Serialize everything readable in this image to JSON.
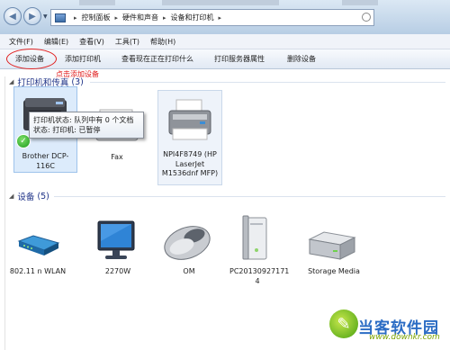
{
  "address_bar": {
    "path": [
      "控制面板",
      "硬件和声音",
      "设备和打印机"
    ]
  },
  "menu": {
    "items": [
      "文件(F)",
      "编辑(E)",
      "查看(V)",
      "工具(T)",
      "帮助(H)"
    ]
  },
  "command_bar": {
    "add_device": "添加设备",
    "add_printer": "添加打印机",
    "see_printing": "查看现在正在打印什么",
    "print_server": "打印服务器属性",
    "remove_device": "删除设备"
  },
  "annotation": "点击添加设备",
  "printers_section": {
    "title": "打印机和传真",
    "count": "(3)",
    "items": [
      {
        "label": "Brother DCP-116C",
        "icon": "multifunction-printer-icon"
      },
      {
        "label": "Fax",
        "icon": "fax-icon"
      },
      {
        "label": "NPI4F8749 (HP LaserJet M1536dnf MFP)",
        "icon": "laser-printer-icon"
      }
    ]
  },
  "tooltip": {
    "line1": "打印机状态: 队列中有 0 个文档",
    "line2": "状态: 打印机: 已暂停"
  },
  "devices_section": {
    "title": "设备",
    "count": "(5)",
    "items": [
      {
        "label": "802.11 n WLAN",
        "icon": "wlan-router-icon"
      },
      {
        "label": "2270W",
        "icon": "monitor-icon"
      },
      {
        "label": "OM",
        "icon": "mouse-icon"
      },
      {
        "label": "PC20130927171 4",
        "icon": "pc-tower-icon"
      },
      {
        "label": "Storage Media",
        "icon": "storage-drive-icon"
      }
    ]
  },
  "watermark": {
    "text": "当客软件园",
    "url": "www.downkr.com"
  },
  "colors": {
    "section_title": "#1e3287",
    "annotation_red": "#e01a1a",
    "selection_bg": "#dcebfb"
  }
}
